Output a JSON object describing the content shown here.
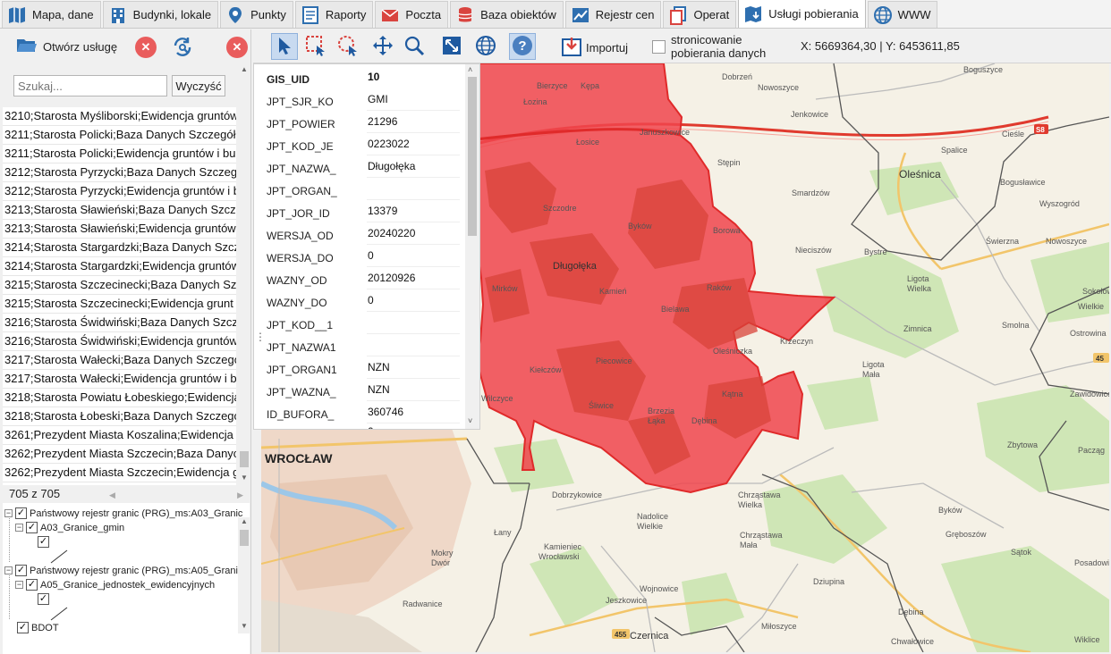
{
  "tabs": [
    {
      "label": "Mapa, dane",
      "icon": "map-icon"
    },
    {
      "label": "Budynki, lokale",
      "icon": "building-icon"
    },
    {
      "label": "Punkty",
      "icon": "pin-icon"
    },
    {
      "label": "Raporty",
      "icon": "report-icon"
    },
    {
      "label": "Poczta",
      "icon": "mail-icon"
    },
    {
      "label": "Baza obiektów",
      "icon": "database-icon"
    },
    {
      "label": "Rejestr cen",
      "icon": "price-chart-icon"
    },
    {
      "label": "Operat",
      "icon": "operat-icon"
    },
    {
      "label": "Usługi pobierania",
      "icon": "download-map-icon"
    },
    {
      "label": "WWW",
      "icon": "globe-icon"
    }
  ],
  "left_panel": {
    "open_service_label": "Otwórz usługę",
    "search_placeholder": "Szukaj...",
    "clear_label": "Wyczyść",
    "services": [
      "3210;Starosta Myśliborski;Ewidencja gruntów",
      "3211;Starosta Policki;Baza Danych Szczegółowych",
      "3211;Starosta Policki;Ewidencja gruntów i bu",
      "3212;Starosta Pyrzycki;Baza Danych Szczegó",
      "3212;Starosta Pyrzycki;Ewidencja gruntów i b",
      "3213;Starosta Sławieński;Baza Danych Szcze",
      "3213;Starosta Sławieński;Ewidencja gruntów",
      "3214;Starosta Stargardzki;Baza Danych Szcz",
      "3214;Starosta Stargardzki;Ewidencja gruntów",
      "3215;Starosta Szczecinecki;Baza Danych Szc",
      "3215;Starosta Szczecinecki;Ewidencja grunt",
      "3216;Starosta Świdwiński;Baza Danych Szcz",
      "3216;Starosta Świdwiński;Ewidencja gruntów",
      "3217;Starosta Wałecki;Baza Danych Szczegó",
      "3217;Starosta Wałecki;Ewidencja gruntów i b",
      "3218;Starosta Powiatu Łobeskiego;Ewidencja",
      "3218;Starosta Łobeski;Baza Danych Szczegó",
      "3261;Prezydent Miasta Koszalina;Ewidencja g",
      "3262;Prezydent Miasta Szczecin;Baza Danych",
      "3262;Prezydent Miasta Szczecin;Ewidencja g"
    ],
    "count_label": "705 z 705",
    "layers": {
      "l1": "Państwowy rejestr granic (PRG)_ms:A03_Granic",
      "l1a": "A03_Granice_gmin",
      "l2": "Państwowy rejestr granic (PRG)_ms:A05_Granic",
      "l2a": "A05_Granice_jednostek_ewidencyjnych",
      "l3": "BDOT"
    }
  },
  "toolbar": {
    "import_label": "Importuj",
    "paging_label": "stronicowanie pobierania danych",
    "coords": "X: 5669364,30 | Y: 6453611,85"
  },
  "attributes": {
    "header_key": "GIS_UID",
    "header_value": "10",
    "rows": [
      {
        "key": "JPT_SJR_KO",
        "value": "GMI"
      },
      {
        "key": "JPT_POWIER",
        "value": "21296"
      },
      {
        "key": "JPT_KOD_JE",
        "value": "0223022"
      },
      {
        "key": "JPT_NAZWA_",
        "value": "Długołęka"
      },
      {
        "key": "JPT_ORGAN_",
        "value": ""
      },
      {
        "key": "JPT_JOR_ID",
        "value": "13379"
      },
      {
        "key": "WERSJA_OD",
        "value": "20240220"
      },
      {
        "key": "WERSJA_DO",
        "value": "0"
      },
      {
        "key": "WAZNY_OD",
        "value": "20120926"
      },
      {
        "key": "WAZNY_DO",
        "value": "0"
      },
      {
        "key": "JPT_KOD__1",
        "value": ""
      },
      {
        "key": "JPT_NAZWA1",
        "value": ""
      },
      {
        "key": "JPT_ORGAN1",
        "value": "NZN"
      },
      {
        "key": "JPT_WAZNA_",
        "value": "NZN"
      },
      {
        "key": "ID_BUFORA_",
        "value": "360746"
      },
      {
        "key": "",
        "value": "0"
      }
    ]
  },
  "map": {
    "places": [
      "Bierzyce",
      "Kępa",
      "Łozina",
      "Dobrzeń",
      "Bogusżyce",
      "Boguszyce",
      "Nowoszyce",
      "Jenkowice",
      "Januszkowice",
      "Łosice",
      "Stępin",
      "Oleśnica",
      "Spalice",
      "Cieśle",
      "Bogusławice",
      "Szczodre",
      "Smardzów",
      "Wyszogród",
      "Byków",
      "Borowa",
      "Nieciszów",
      "Bystre",
      "Świerzna",
      "Nowoszyce",
      "Długołęka",
      "Mirków",
      "Kamień",
      "Raków",
      "Ligota Wielka",
      "Sokołowice",
      "Smolna",
      "Bielawa",
      "Zimnica",
      "Ostrowina",
      "Krzeczyn",
      "Ligota Mała",
      "Kiełczów",
      "Piecowice",
      "Oleśniczka",
      "Kątna",
      "Wilczyce",
      "Śliwice",
      "Brzezia Łąka",
      "Dębina",
      "Zawidowice",
      "Zbytowa",
      "Pacząg",
      "Dobrzykowice",
      "Chrząstawa Wielka",
      "Nadolice Wielkie",
      "Chrząstawa Mała",
      "Kamieniec Wrocławski",
      "Łany",
      "Mokry Dwór",
      "Wojnowice",
      "Jeszkowice",
      "Radwanice",
      "Czernica",
      "Dziupina",
      "Miłoszyce",
      "Dębina",
      "Chwałowice",
      "Byków",
      "Gręboszów",
      "Sątok",
      "Posadowice",
      "Wiklice",
      "WROCŁAW",
      "S8",
      "455",
      "455",
      "45"
    ]
  },
  "colors": {
    "highlight_fill": "#f0454c",
    "highlight_stroke": "#e02a2a",
    "forest": "#cfe6b6",
    "road_main": "#e03a2e",
    "accent_tab": "#1e73be"
  }
}
